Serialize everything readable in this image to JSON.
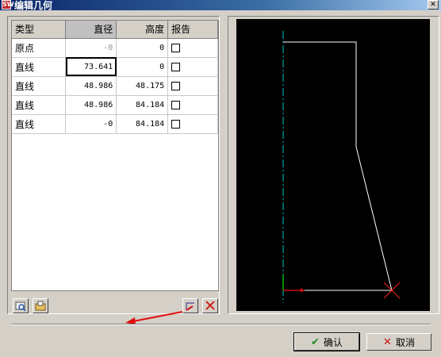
{
  "window": {
    "title": "编辑几何",
    "app_icon_text": "SW"
  },
  "table": {
    "headers": {
      "type": "类型",
      "diameter": "直径",
      "height": "高度",
      "report": "报告"
    },
    "rows": [
      {
        "type": "原点",
        "diameter": "-0",
        "height": "0"
      },
      {
        "type": "直线",
        "diameter": "73.641",
        "height": "0"
      },
      {
        "type": "直线",
        "diameter": "48.986",
        "height": "48.175"
      },
      {
        "type": "直线",
        "diameter": "48.986",
        "height": "84.184"
      },
      {
        "type": "直线",
        "diameter": "-0",
        "height": "84.184"
      }
    ]
  },
  "buttons": {
    "ok": "确认",
    "cancel": "取消"
  },
  "colors": {
    "canvas_bg": "#000000",
    "axis": "#00c8c8",
    "profile": "#ffffff",
    "marker": "#ff0000",
    "ok_check": "#2a8a2a"
  },
  "icons": {
    "open": "open-file-icon",
    "save": "save-icon",
    "add": "add-point-icon",
    "delete": "delete-icon",
    "ok": "check-icon",
    "cancel": "x-icon"
  }
}
